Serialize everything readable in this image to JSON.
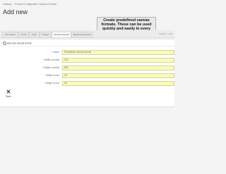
{
  "breadcrumb": {
    "items": [
      "Catalog",
      "Product Configurator Canvas Formats"
    ]
  },
  "page": {
    "title": "Add new"
  },
  "tabs": {
    "items": [
      "Information",
      "Fonts",
      "Color",
      "Images",
      "Canvas Formats",
      "Backing and frame"
    ],
    "active_index": 4,
    "right_text": "Version: 1.0.0"
  },
  "callout": {
    "text": "Create predefined canvas formats. These can be used quickly and easily in every product."
  },
  "panel": {
    "heading": "Add new canvas format"
  },
  "form": {
    "rows": [
      {
        "label": "Name",
        "required": true,
        "is_link": true,
        "value": "Predefined canvas format"
      },
      {
        "label": "Width in pixels",
        "required": true,
        "is_link": false,
        "value": "120"
      },
      {
        "label": "Height in pixels",
        "required": true,
        "is_link": false,
        "value": "800"
      },
      {
        "label": "Width in mm",
        "required": true,
        "is_link": false,
        "value": "29"
      },
      {
        "label": "Height in mm",
        "required": true,
        "is_link": false,
        "value": "30"
      }
    ]
  },
  "actions": {
    "save_label": "Save",
    "save_icon": "close-icon"
  },
  "colors": {
    "field_highlight": "#fbfbb9",
    "accent_link": "#3a79c9",
    "required": "#dd3333"
  }
}
